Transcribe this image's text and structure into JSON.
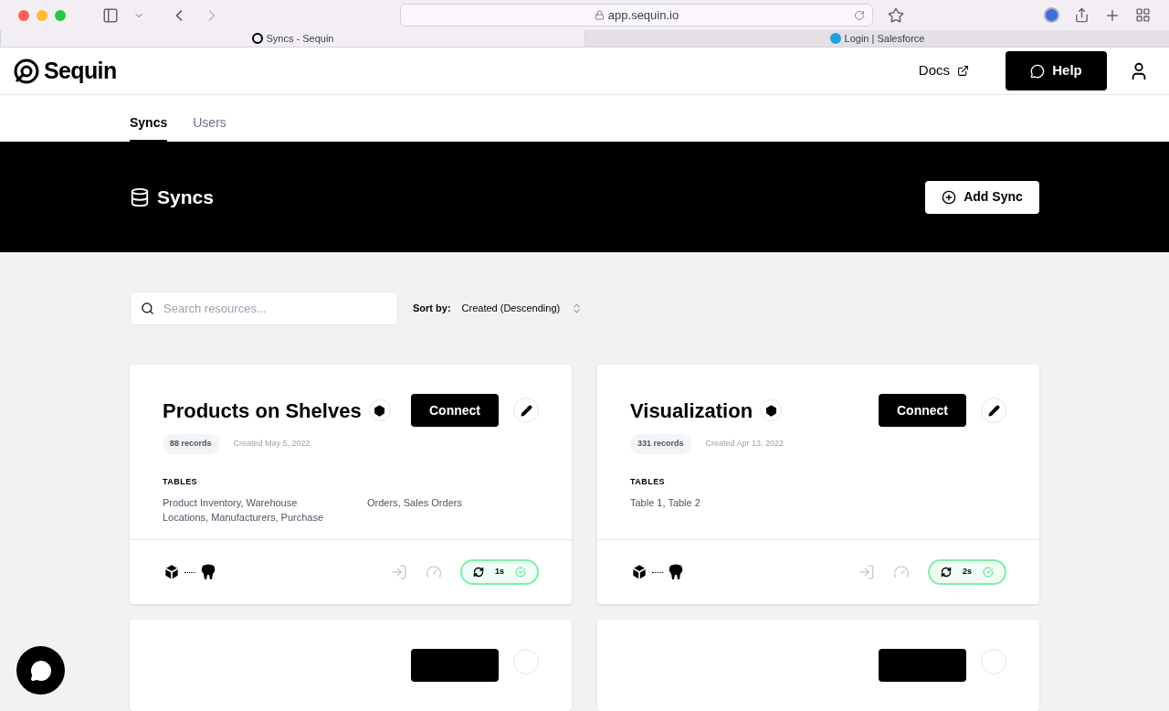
{
  "browser": {
    "url": "app.sequin.io",
    "tabs": [
      {
        "title": "Syncs - Sequin",
        "selected": true
      },
      {
        "title": "Login | Salesforce",
        "selected": false
      }
    ]
  },
  "header": {
    "logo": "Sequin",
    "docs": "Docs",
    "help": "Help"
  },
  "nav_tabs": [
    {
      "label": "Syncs",
      "selected": true
    },
    {
      "label": "Users",
      "selected": false
    }
  ],
  "banner": {
    "title": "Syncs",
    "add_button": "Add Sync"
  },
  "search": {
    "placeholder": "Search resources..."
  },
  "sort": {
    "label": "Sort by:",
    "value": "Created (Descending)"
  },
  "cards": [
    {
      "name": "Products on Shelves",
      "connect": "Connect",
      "records": "88 records",
      "created": "Created May 5, 2022",
      "tables_heading": "TABLES",
      "tables": [
        "Product Inventory, Warehouse Locations, Manufacturers, Purchase",
        "Orders, Sales Orders"
      ],
      "sync_time": "1s"
    },
    {
      "name": "Visualization",
      "connect": "Connect",
      "records": "331 records",
      "created": "Created Apr 13, 2022",
      "tables_heading": "TABLES",
      "tables": [
        "Table 1, Table 2"
      ],
      "sync_time": "2s"
    }
  ]
}
